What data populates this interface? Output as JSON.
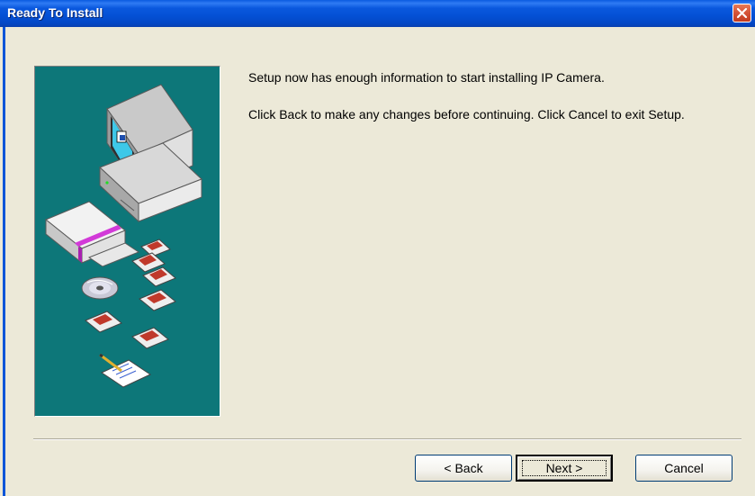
{
  "window": {
    "title": "Ready To Install"
  },
  "content": {
    "message1": "Setup now has enough information to start installing IP Camera.",
    "message2": "Click Back to make any changes before continuing. Click Cancel to exit Setup."
  },
  "buttons": {
    "back_label": "< Back",
    "next_label": "Next >",
    "cancel_label": "Cancel"
  },
  "icons": {
    "close": "close-icon",
    "illustration": "setup-illustration"
  },
  "colors": {
    "titlebar": "#0450d4",
    "panel": "#0d7779",
    "dialog_bg": "#ece9d8",
    "close_button": "#d6553a"
  }
}
